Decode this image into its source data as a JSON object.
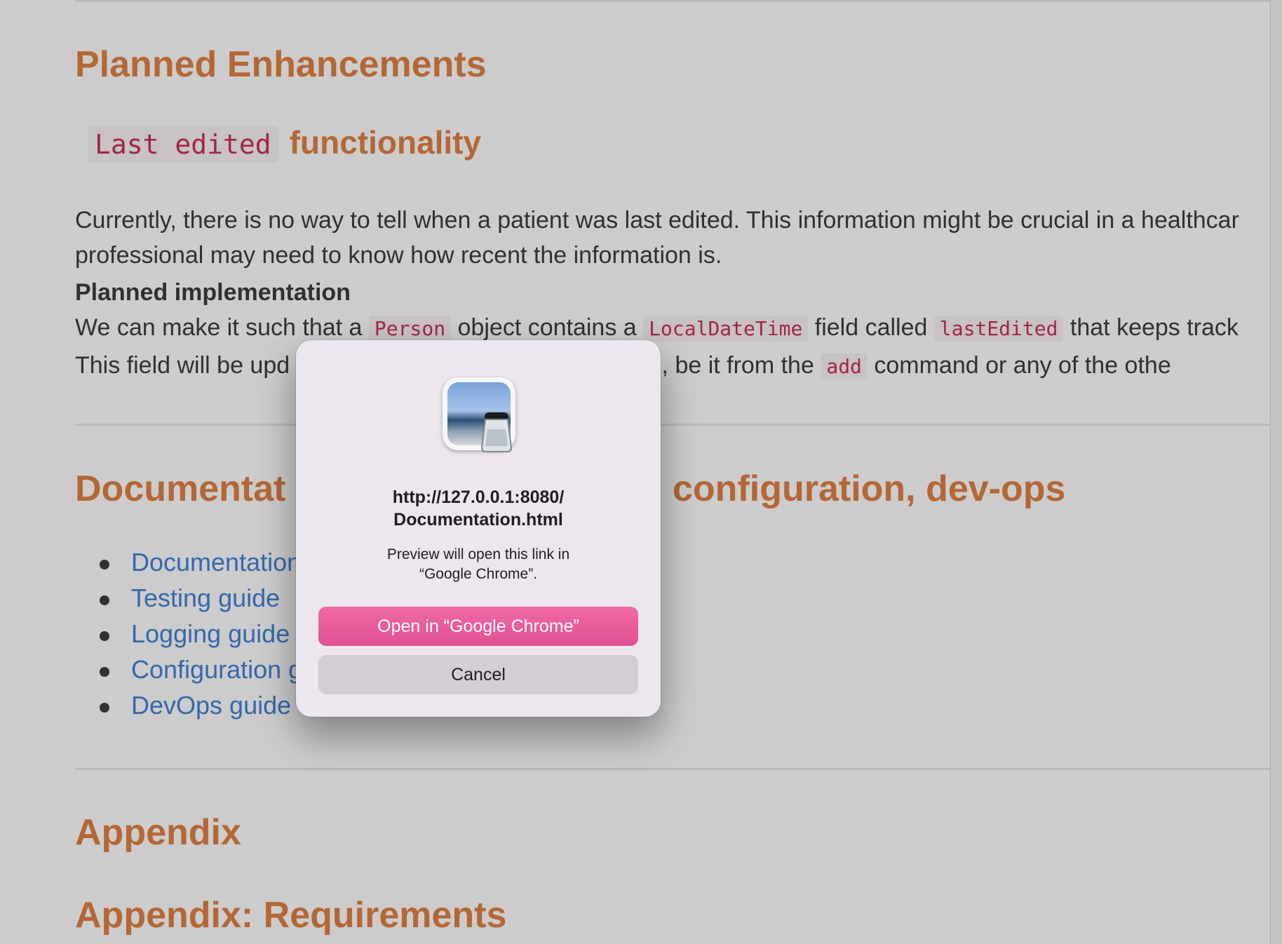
{
  "document": {
    "h1_planned": "Planned Enhancements",
    "h2_code": "Last edited",
    "h2_text": "functionality",
    "para1_line1": "Currently, there is no way to tell when a patient was last edited. This information might be crucial in a healthcar",
    "para1_line2": "professional may need to know how recent the information is.",
    "impl_heading": "Planned implementation",
    "para2_a": "We can make it such that a",
    "para2_code1": "Person",
    "para2_b": "object contains a",
    "para2_code2": "LocalDateTime",
    "para2_c": "field called",
    "para2_code3": "lastEdited",
    "para2_d": "that keeps track",
    "para3_a": "This field will be upd",
    "para3_b": "reated, be it from the",
    "para3_code": "add",
    "para3_c": "command or any of the othe",
    "h1_docs_left": "Documentat",
    "h1_docs_right": "configuration, dev-ops",
    "links": [
      "Documentation",
      "Testing guide",
      "Logging guide",
      "Configuration g",
      "DevOps guide"
    ],
    "h1_appendix": "Appendix",
    "h1_requirements": "Appendix: Requirements"
  },
  "dialog": {
    "app_icon": "preview-app-icon",
    "url_line1": "http://127.0.0.1:8080/",
    "url_line2": "Documentation.html",
    "message_line1": "Preview will open this link in",
    "message_line2": "“Google Chrome”.",
    "open_button": "Open in “Google Chrome”",
    "cancel_button": "Cancel"
  },
  "colors": {
    "heading": "#e07b39",
    "link": "#3a7bd5",
    "code": "#c7254e",
    "primary_button": "#e04f92"
  }
}
